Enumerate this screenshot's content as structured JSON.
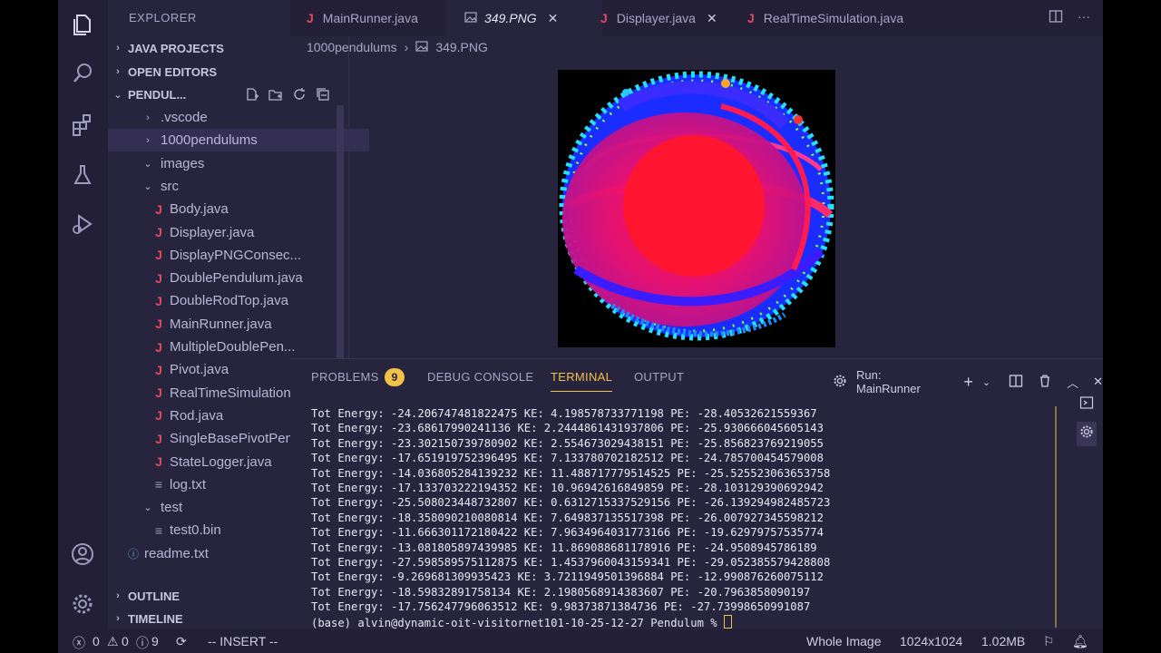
{
  "sidebar": {
    "title": "EXPLORER",
    "more": "···",
    "sections": {
      "java_projects": "JAVA PROJECTS",
      "open_editors": "OPEN EDITORS",
      "pendulum": "PENDUL...",
      "outline": "OUTLINE",
      "timeline": "TIMELINE"
    },
    "tree": [
      {
        "label": ".vscode",
        "kind": "folder",
        "expanded": false
      },
      {
        "label": "1000pendulums",
        "kind": "folder",
        "expanded": false
      },
      {
        "label": "images",
        "kind": "folder",
        "expanded": true
      },
      {
        "label": "src",
        "kind": "folder",
        "expanded": true
      },
      {
        "label": "Body.java",
        "kind": "java"
      },
      {
        "label": "Displayer.java",
        "kind": "java"
      },
      {
        "label": "DisplayPNGConsec...",
        "kind": "java"
      },
      {
        "label": "DoublePendulum.java",
        "kind": "java"
      },
      {
        "label": "DoubleRodTop.java",
        "kind": "java"
      },
      {
        "label": "MainRunner.java",
        "kind": "java"
      },
      {
        "label": "MultipleDoublePen...",
        "kind": "java"
      },
      {
        "label": "Pivot.java",
        "kind": "java"
      },
      {
        "label": "RealTimeSimulation...",
        "kind": "java"
      },
      {
        "label": "Rod.java",
        "kind": "java"
      },
      {
        "label": "SingleBasePivotPen...",
        "kind": "java"
      },
      {
        "label": "StateLogger.java",
        "kind": "java"
      },
      {
        "label": "log.txt",
        "kind": "text"
      },
      {
        "label": "test",
        "kind": "folder",
        "expanded": true
      },
      {
        "label": "test0.bin",
        "kind": "text"
      },
      {
        "label": "readme.txt",
        "kind": "info"
      }
    ]
  },
  "tabs": [
    {
      "label": "MainRunner.java",
      "kind": "java"
    },
    {
      "label": "349.PNG",
      "kind": "image",
      "active": true,
      "close": "✕"
    },
    {
      "label": "Displayer.java",
      "kind": "java",
      "close": "✕"
    },
    {
      "label": "RealTimeSimulation.java",
      "kind": "java"
    }
  ],
  "breadcrumb": {
    "folder": "1000pendulums",
    "file": "349.PNG"
  },
  "panel": {
    "tabs": {
      "problems": "PROBLEMS",
      "debug": "DEBUG CONSOLE",
      "terminal": "TERMINAL",
      "output": "OUTPUT"
    },
    "problems_count": "9",
    "run_label": "Run: MainRunner",
    "terminal_lines": [
      "Tot Energy: -24.206747481822475 KE: 4.198578733771198 PE: -28.40532621559367",
      "Tot Energy: -23.68617990241136 KE: 2.2444861431937806 PE: -25.930666045605143",
      "Tot Energy: -23.302150739780902 KE: 2.554673029438151 PE: -25.856823769219055",
      "Tot Energy: -17.651919752396495 KE: 7.133780702182512 PE: -24.785700454579008",
      "Tot Energy: -14.036805284139232 KE: 11.488717779514525 PE: -25.525523063653758",
      "Tot Energy: -17.133703222194352 KE: 10.96942616849859 PE: -28.103129390692942",
      "Tot Energy: -25.508023448732807 KE: 0.6312715337529156 PE: -26.139294982485723",
      "Tot Energy: -18.358090210080814 KE: 7.649837135517398 PE: -26.007927345598212",
      "Tot Energy: -11.666301172180422 KE: 7.9634964031773166 PE: -19.62979757535774",
      "Tot Energy: -13.081805897439985 KE: 11.869088681178916 PE: -24.9508945786189",
      "Tot Energy: -27.598589575112875 KE: 1.4537960043159341 PE: -29.052385579428808",
      "Tot Energy: -9.269681309935423 KE: 3.7211949501396884 PE: -12.990876260075112",
      "Tot Energy: -18.59832891758134 KE: 2.1980568914383607 PE: -20.7963858090197",
      "Tot Energy: -17.756247796063512 KE: 9.98373871384736 PE: -27.73998650991087"
    ],
    "prompt": "(base) alvin@dynamic-oit-visitornet101-10-25-12-27 Pendulum % "
  },
  "status": {
    "errors": "0",
    "warnings": "0",
    "info": "9",
    "mode": "-- INSERT --",
    "view": "Whole Image",
    "dimensions": "1024x1024",
    "size": "1.02MB"
  },
  "colors": {
    "accent": "#f3c04a",
    "java": "#e04a5f",
    "background": "#27243d"
  }
}
